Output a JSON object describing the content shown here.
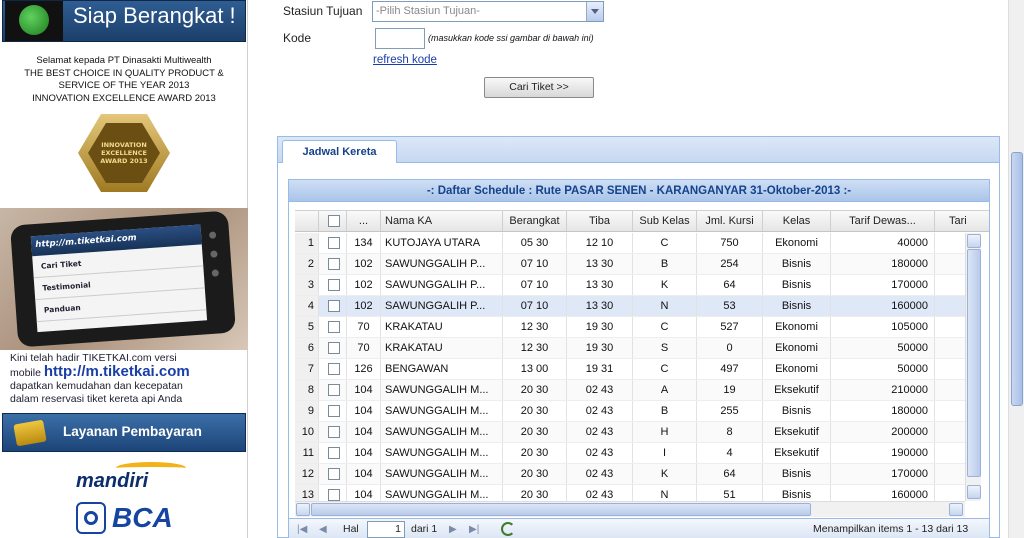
{
  "sidebar": {
    "banner_title": "Siap Berangkat !",
    "congrats_lines": [
      "Selamat kepada PT Dinasakti Multiwealth",
      "THE BEST CHOICE IN QUALITY PRODUCT &",
      "SERVICE OF THE YEAR 2013",
      "INNOVATION EXCELLENCE AWARD 2013"
    ],
    "award_lines": [
      "INNOVATION",
      "EXCELLENCE",
      "AWARD 2013"
    ],
    "phone": {
      "header": "http://m.tiketkai.com",
      "items": [
        "Cari Tiket",
        "Testimonial",
        "Panduan"
      ]
    },
    "mobile_text": {
      "line1": "Kini telah hadir TIKETKAI.com versi",
      "line2_prefix": "mobile ",
      "url": "http://m.tiketkai.com",
      "line3": "dapatkan kemudahan dan kecepatan",
      "line4": "dalam reservasi tiket kereta api Anda"
    },
    "payment_button": "Layanan Pembayaran",
    "bank_1": "mandiri",
    "bank_2": "BCA"
  },
  "form": {
    "stasiun_tujuan_label": "Stasiun Tujuan",
    "stasiun_tujuan_value": "-Pilih Stasiun Tujuan-",
    "kode_label": "Kode",
    "kode_value": "",
    "kode_hint": "(masukkan kode ssi gambar di bawah ini)",
    "refresh_link": "refresh kode",
    "search_button": "Cari Tiket >>"
  },
  "tab": {
    "label": "Jadwal Kereta"
  },
  "grid": {
    "title": "-: Daftar Schedule : Rute PASAR SENEN - KARANGANYAR 31-Oktober-2013 :-",
    "columns": [
      "",
      "",
      "...",
      "Nama KA",
      "Berangkat",
      "Tiba",
      "Sub Kelas",
      "Jml. Kursi",
      "Kelas",
      "Tarif Dewas...",
      "Tari"
    ],
    "rows": [
      [
        "1",
        "134",
        "KUTOJAYA UTARA",
        "05 30",
        "12 10",
        "C",
        "750",
        "Ekonomi",
        "40000"
      ],
      [
        "2",
        "102",
        "SAWUNGGALIH P...",
        "07 10",
        "13 30",
        "B",
        "254",
        "Bisnis",
        "180000"
      ],
      [
        "3",
        "102",
        "SAWUNGGALIH P...",
        "07 10",
        "13 30",
        "K",
        "64",
        "Bisnis",
        "170000"
      ],
      [
        "4",
        "102",
        "SAWUNGGALIH P...",
        "07 10",
        "13 30",
        "N",
        "53",
        "Bisnis",
        "160000"
      ],
      [
        "5",
        "70",
        "KRAKATAU",
        "12 30",
        "19 30",
        "C",
        "527",
        "Ekonomi",
        "105000"
      ],
      [
        "6",
        "70",
        "KRAKATAU",
        "12 30",
        "19 30",
        "S",
        "0",
        "Ekonomi",
        "50000"
      ],
      [
        "7",
        "126",
        "BENGAWAN",
        "13 00",
        "19 31",
        "C",
        "497",
        "Ekonomi",
        "50000"
      ],
      [
        "8",
        "104",
        "SAWUNGGALIH M...",
        "20 30",
        "02 43",
        "A",
        "19",
        "Eksekutif",
        "210000"
      ],
      [
        "9",
        "104",
        "SAWUNGGALIH M...",
        "20 30",
        "02 43",
        "B",
        "255",
        "Bisnis",
        "180000"
      ],
      [
        "10",
        "104",
        "SAWUNGGALIH M...",
        "20 30",
        "02 43",
        "H",
        "8",
        "Eksekutif",
        "200000"
      ],
      [
        "11",
        "104",
        "SAWUNGGALIH M...",
        "20 30",
        "02 43",
        "I",
        "4",
        "Eksekutif",
        "190000"
      ],
      [
        "12",
        "104",
        "SAWUNGGALIH M...",
        "20 30",
        "02 43",
        "K",
        "64",
        "Bisnis",
        "170000"
      ],
      [
        "13",
        "104",
        "SAWUNGGALIH M...",
        "20 30",
        "02 43",
        "N",
        "51",
        "Bisnis",
        "160000"
      ]
    ],
    "selected_row": 4
  },
  "pager": {
    "page_label": "Hal",
    "page_value": "1",
    "of_label": "dari 1",
    "summary": "Menampilkan items 1 - 13 dari 13"
  }
}
